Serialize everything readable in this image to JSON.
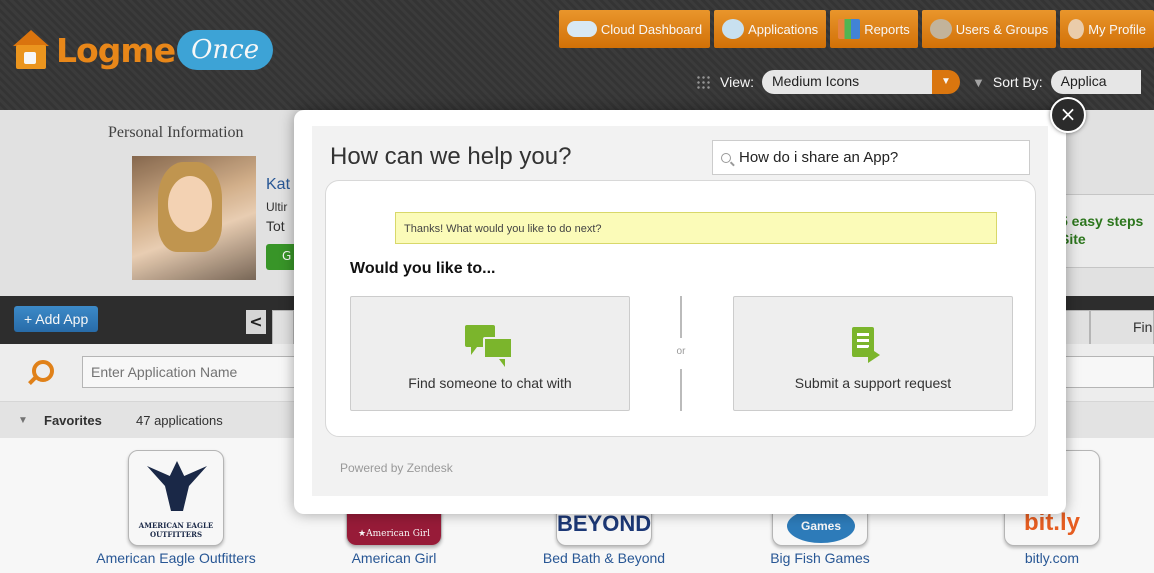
{
  "header": {
    "logo_left": "Logme",
    "logo_right": "Once",
    "nav": [
      {
        "label": "Cloud Dashboard",
        "icon": "cloud-icon"
      },
      {
        "label": "Applications",
        "icon": "globe-icon"
      },
      {
        "label": "Reports",
        "icon": "chart-icon"
      },
      {
        "label": "Users & Groups",
        "icon": "users-icon"
      },
      {
        "label": "My Profile",
        "icon": "profile-icon"
      }
    ],
    "view_label": "View:",
    "view_value": "Medium Icons",
    "sort_label": "Sort By:",
    "sort_value": "Applica"
  },
  "personal": {
    "title": "Personal Information",
    "name": "Kat",
    "line1": "Ultir",
    "line2": "Tot",
    "button": "G",
    "promo": "5 easy steps Site"
  },
  "appbar": {
    "add_app": "+ Add App",
    "prev": "<",
    "tab_right": "Fin"
  },
  "search": {
    "placeholder": "Enter Application Name"
  },
  "favorites": {
    "title": "Favorites",
    "count": "47 applications",
    "apps": [
      {
        "label": "American Eagle Outfitters",
        "icon_text": "AMERICAN EAGLE OUTFITTERS"
      },
      {
        "label": "American Girl",
        "icon_text": "★American Girl"
      },
      {
        "label": "Bed Bath & Beyond",
        "icon_text": "BEYOND"
      },
      {
        "label": "Big Fish Games",
        "icon_text": "Games"
      },
      {
        "label": "bitly.com",
        "icon_text": "bit.ly"
      }
    ]
  },
  "modal": {
    "close": "×",
    "title": "How can we help you?",
    "search_value": "How do i share an App?",
    "notice": "Thanks! What would you like to do next?",
    "prompt": "Would you like to...",
    "option_chat": "Find someone to chat with",
    "option_submit": "Submit a support request",
    "or": "or",
    "powered": "Powered by Zendesk"
  },
  "colors": {
    "accent_orange": "#e8861a",
    "green": "#7bb52c",
    "link_blue": "#2a5a9a"
  }
}
